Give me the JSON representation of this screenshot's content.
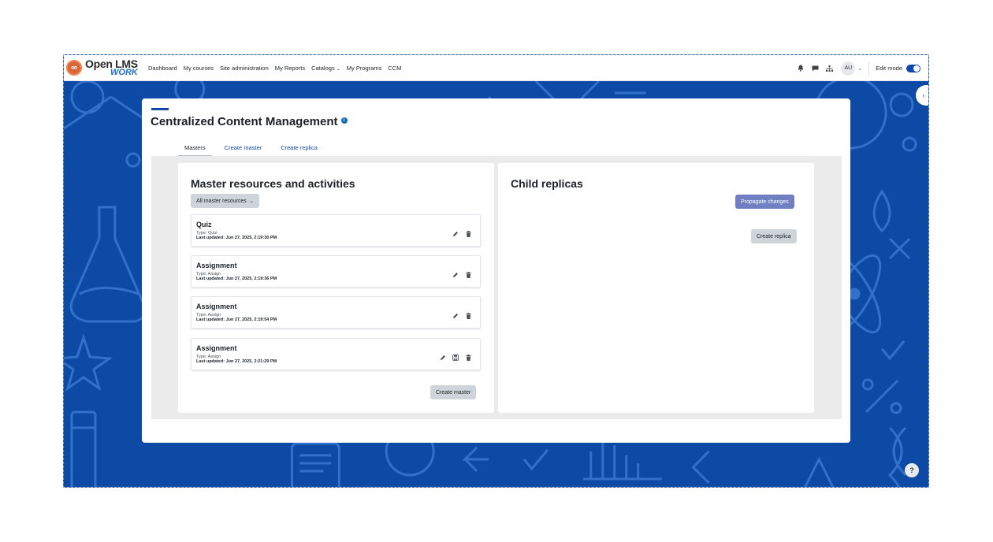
{
  "brand": {
    "name_top": "Open LMS",
    "name_bottom": "WORK"
  },
  "nav": {
    "links": [
      "Dashboard",
      "My courses",
      "Site administration",
      "My Reports",
      "Catalogs",
      "My Programs",
      "CCM"
    ],
    "catalogs_has_dropdown": true,
    "avatar_initials": "AU",
    "edit_mode_label": "Edit mode",
    "edit_mode_on": true
  },
  "page": {
    "title": "Centralized Content Management",
    "tabs": [
      "Masters",
      "Create master",
      "Create replica"
    ],
    "active_tab": "Masters"
  },
  "masters": {
    "title": "Master resources and activities",
    "filter_label": "All master resources",
    "items": [
      {
        "title": "Quiz",
        "type": "Type: Quiz",
        "updated": "Last updated: Jun 27, 2025, 2:19:30 PM"
      },
      {
        "title": "Assignment",
        "type": "Type: Assign",
        "updated": "Last updated: Jun 27, 2025, 2:19:36 PM"
      },
      {
        "title": "Assignment",
        "type": "Type: Assign",
        "updated": "Last updated: Jun 27, 2025, 2:19:54 PM"
      },
      {
        "title": "Assignment",
        "type": "Type: Assign",
        "updated": "Last updated: Jun 27, 2025, 2:21:29 PM"
      }
    ],
    "create_button": "Create master"
  },
  "replicas": {
    "title": "Child replicas",
    "propagate_button": "Propagate changes",
    "create_button": "Create replica"
  },
  "help_label": "?",
  "colors": {
    "accent": "#0f47ad",
    "background_pattern": "#0d4aa6",
    "propagate_button": "#6f7fc1"
  }
}
